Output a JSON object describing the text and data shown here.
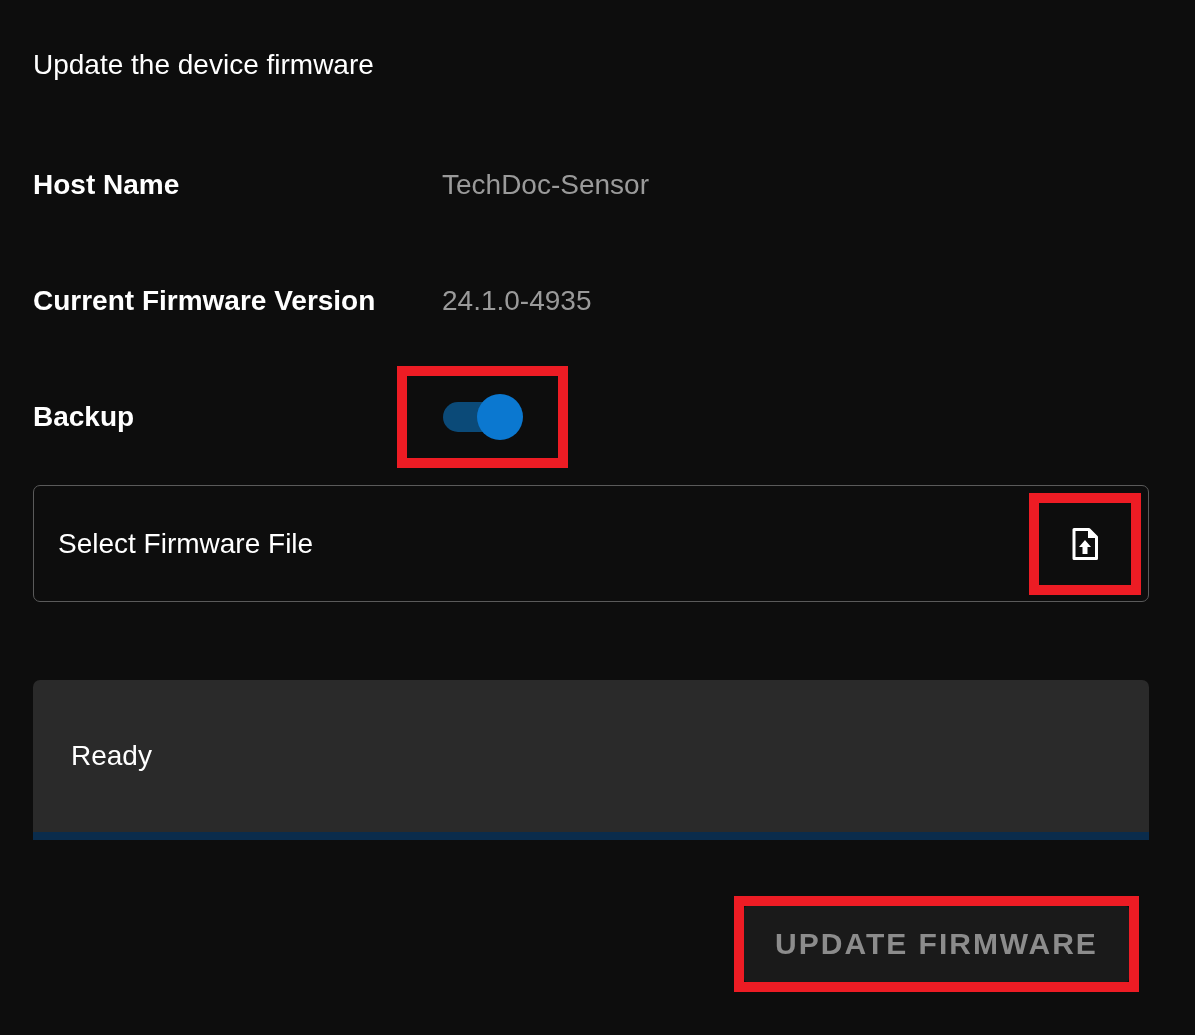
{
  "title": "Update the device firmware",
  "fields": [
    {
      "label": "Host Name",
      "value": "TechDoc-Sensor"
    },
    {
      "label": "Current Firmware Version",
      "value": "24.1.0-4935"
    }
  ],
  "backup": {
    "label": "Backup",
    "on": true,
    "highlighted": true
  },
  "file_field": {
    "placeholder": "Select Firmware File",
    "upload_highlighted": true
  },
  "status": {
    "text": "Ready",
    "level": 0
  },
  "update_button": {
    "label": "UPDATE FIRMWARE",
    "disabled": true,
    "highlighted": true
  }
}
